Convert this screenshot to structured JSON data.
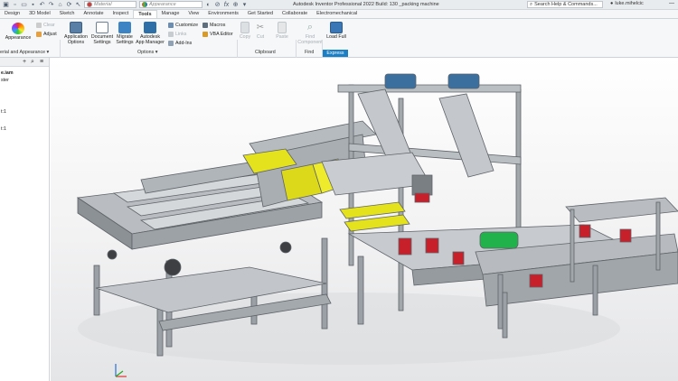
{
  "titlebar": {
    "title": "Autodesk Inventor Professional 2022 Build: 130   _packing machine",
    "material_combo": "Material",
    "appearance_combo": "Appearance",
    "search_placeholder": "Search Help & Commands...",
    "user": "luke.mihelcic"
  },
  "tabs": [
    "Design",
    "3D Model",
    "Sketch",
    "Annotate",
    "Inspect",
    "Tools",
    "Manage",
    "View",
    "Environments",
    "Get Started",
    "Collaborate",
    "Electromechanical"
  ],
  "active_tab": "Tools",
  "ribbon": {
    "appearance": "Appearance",
    "clear": "Clear",
    "adjust": "Adjust",
    "application_options": [
      "Application",
      "Options"
    ],
    "document_settings": [
      "Document",
      "Settings"
    ],
    "migrate_settings": [
      "Migrate",
      "Settings"
    ],
    "autodesk_app_manager": [
      "Autodesk",
      "App Manager"
    ],
    "customize": "Customize",
    "links": "Links",
    "add_ins": "Add-Ins",
    "macros": "Macros",
    "vba_editor": "VBA Editor",
    "copy": "Copy",
    "cut": "Cut",
    "paste": "Paste",
    "find_component": [
      "Find",
      "Component"
    ],
    "load_full": [
      "Load Full"
    ],
    "panels": {
      "material_appearance": "erial and Appearance ▾",
      "options": "Options ▾",
      "clipboard": "Clipboard",
      "find": "Find",
      "express": "Express"
    }
  },
  "browser": {
    "items": [
      "e.iam",
      "ster",
      "t:1",
      "t:1"
    ]
  },
  "colors": {
    "accent": "#1a7fc4",
    "frame": "#8c9196",
    "yellow": "#e4e21c",
    "red": "#c8202b",
    "green": "#21b24b",
    "motor_blue": "#3b6f9e"
  }
}
